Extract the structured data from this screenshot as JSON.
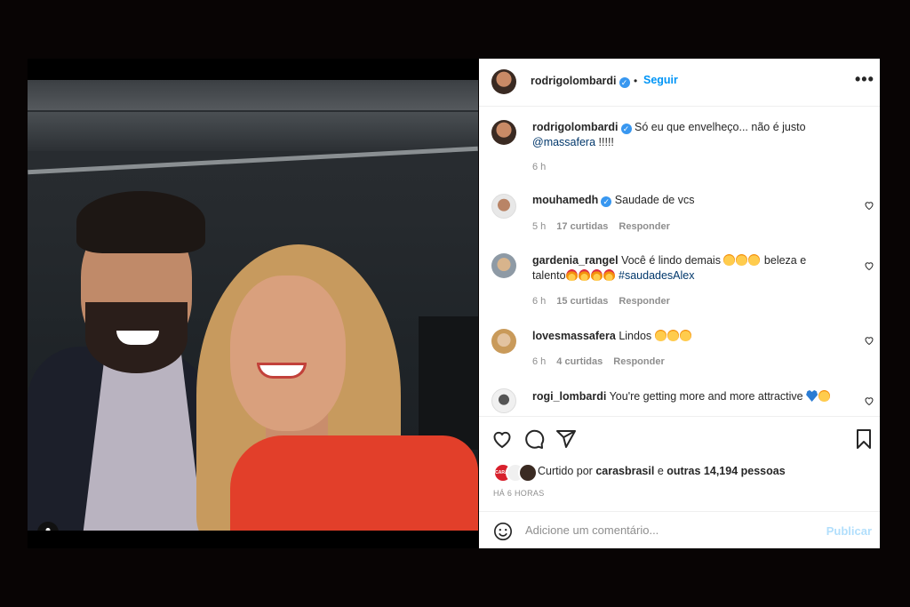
{
  "post": {
    "author": "rodrigolombardi",
    "follow_label": "Seguir",
    "separator": "•",
    "more_label": "•••",
    "caption_text": "Só eu que envelheço... não é justo",
    "caption_mention": "@massafera",
    "caption_suffix": " !!!!!",
    "caption_time": "6 h"
  },
  "comments": [
    {
      "user": "mouhamedh",
      "verified": true,
      "text": "Saudade de vcs",
      "time": "5 h",
      "likes": "17 curtidas",
      "reply": "Responder"
    },
    {
      "user": "gardenia_rangel",
      "verified": false,
      "text": "Você é lindo demais",
      "text2": "beleza e",
      "text3": "talento",
      "hashtag": "#saudadesAlex",
      "time": "6 h",
      "likes": "15 curtidas",
      "reply": "Responder"
    },
    {
      "user": "lovesmassafera",
      "verified": false,
      "text": "Lindos",
      "time": "6 h",
      "likes": "4 curtidas",
      "reply": "Responder"
    },
    {
      "user": "rogi_lombardi",
      "verified": false,
      "text": "You're getting more and more attractive"
    }
  ],
  "likes_bar": {
    "prefix": "Curtido por ",
    "user": "carasbrasil",
    "middle": " e ",
    "others": "outras 14,194 pessoas",
    "badge1": "CARAS",
    "time_ago": "HÁ 6 HORAS"
  },
  "add_comment": {
    "placeholder": "Adicione um comentário...",
    "publish_label": "Publicar"
  },
  "colors": {
    "accent": "#0095f6",
    "verified": "#3897f0",
    "muted": "#8e8e8e",
    "publish_disabled": "#b2dffc"
  },
  "icons": [
    "user-tag-icon",
    "verified-icon",
    "more-icon",
    "heart-icon",
    "comment-icon",
    "share-icon",
    "bookmark-icon",
    "emoji-icon"
  ]
}
